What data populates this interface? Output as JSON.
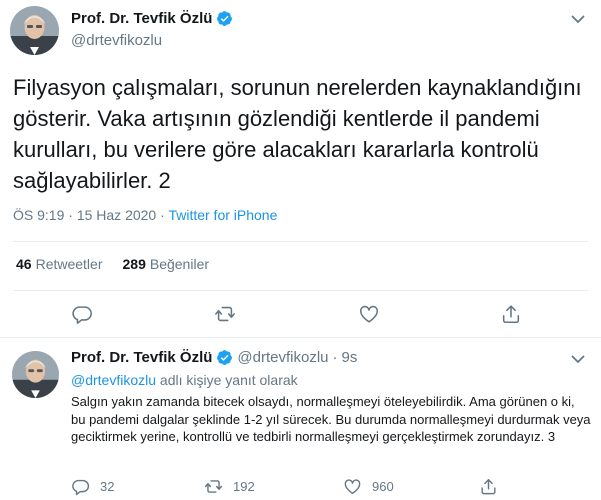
{
  "tweet": {
    "author_name": "Prof. Dr. Tevfik Özlü",
    "author_handle": "@drtevfikozlu",
    "text": "Filyasyon çalışmaları, sorunun nerelerden kaynaklandığını gösterir. Vaka artışının gözlendiği kentlerde il pandemi kurulları, bu verilere göre alacakları kararlarla kontrolü sağlayabilirler. 2",
    "time": "ÖS 9:19",
    "date": "15 Haz 2020",
    "separator": "·",
    "source": "Twitter for iPhone",
    "retweets_count": "46",
    "retweets_label": "Retweetler",
    "likes_count": "289",
    "likes_label": "Beğeniler"
  },
  "reply": {
    "author_name": "Prof. Dr. Tevfik Özlü",
    "author_handle": "@drtevfikozlu",
    "dot": "·",
    "time": "9s",
    "reply_mention": "@drtevfikozlu",
    "reply_suffix": " adlı kişiye yanıt olarak",
    "text": "Salgın yakın zamanda bitecek olsaydı, normalleşmeyi öteleyebilirdik. Ama görünen o ki, bu pandemi dalgalar şeklinde 1-2 yıl sürecek. Bu durumda normalleşmeyi durdurmak veya geciktirmek yerine, kontrollü ve tedbirli normalleşmeyi gerçekleştirmek zorundayız. 3",
    "reply_count": "32",
    "retweet_count": "192",
    "like_count": "960"
  },
  "icons": {
    "verified": "verified-badge-icon",
    "more": "chevron-down-icon",
    "reply": "reply-icon",
    "retweet": "retweet-icon",
    "like": "heart-icon",
    "share": "share-icon"
  },
  "colors": {
    "accent": "#1b95e0",
    "verified": "#1da1f2",
    "secondary_text": "#657786",
    "divider": "#e6ecf0"
  }
}
